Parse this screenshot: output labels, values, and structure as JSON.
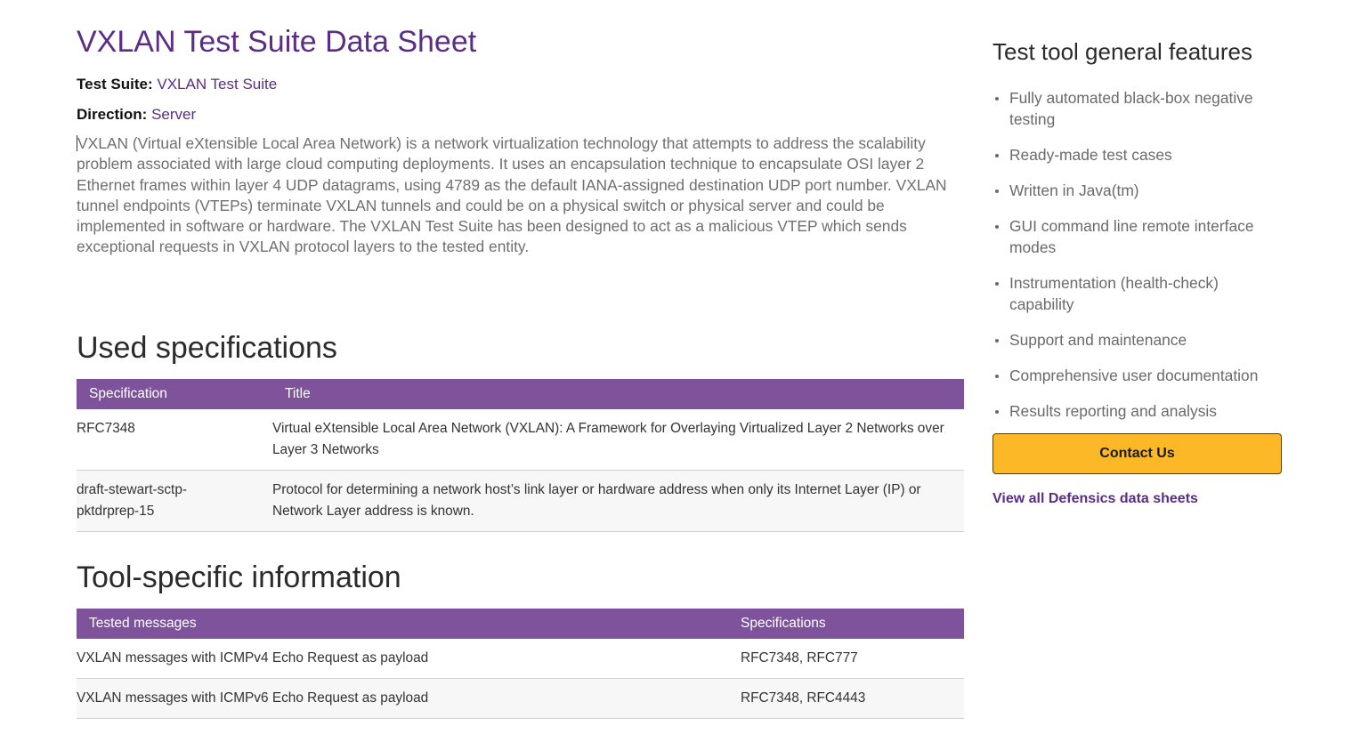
{
  "page": {
    "title": "VXLAN Test Suite Data Sheet",
    "test_suite_label": "Test Suite:",
    "test_suite_value": "VXLAN Test Suite",
    "direction_label": "Direction:",
    "direction_value": "Server",
    "description": "VXLAN (Virtual eXtensible Local Area Network) is a network virtualization technology that attempts to address the scalability problem associated with large cloud computing deployments. It uses an encapsulation technique to encapsulate OSI layer 2 Ethernet frames within layer 4 UDP datagrams, using 4789 as the default IANA-assigned destination UDP port number. VXLAN tunnel endpoints (VTEPs) terminate VXLAN tunnels and could be on a physical switch or physical server and could be implemented in software or hardware. The VXLAN Test Suite has been designed to act as a malicious VTEP which sends exceptional requests in VXLAN protocol layers to the tested entity."
  },
  "used_specs": {
    "heading": "Used specifications",
    "columns": [
      "Specification",
      "Title"
    ],
    "rows": [
      {
        "spec": "RFC7348",
        "title": "Virtual eXtensible Local Area Network (VXLAN): A Framework for Overlaying Virtualized Layer 2 Networks over Layer 3 Networks"
      },
      {
        "spec": "draft-stewart-sctp-pktdrprep-15",
        "title": "Protocol for determining a network host’s link layer or hardware address when only its Internet Layer (IP) or Network Layer address is known."
      }
    ]
  },
  "tool_info": {
    "heading": "Tool-specific information",
    "columns": [
      "Tested messages",
      "Specifications"
    ],
    "rows": [
      {
        "message": "VXLAN messages with ICMPv4 Echo Request as payload",
        "specs": "RFC7348, RFC777"
      },
      {
        "message": "VXLAN messages with ICMPv6 Echo Request as payload",
        "specs": "RFC7348, RFC4443"
      }
    ]
  },
  "sidebar": {
    "heading": "Test tool general features",
    "features": [
      "Fully automated black-box negative testing",
      "Ready-made test cases",
      "Written in Java(tm)",
      "GUI command line remote interface modes",
      "Instrumentation (health-check) capability",
      "Support and maintenance",
      "Comprehensive user documentation",
      "Results reporting and analysis"
    ],
    "contact_label": "Contact Us",
    "view_all_label": "View all Defensics data sheets"
  },
  "colors": {
    "brand_purple": "#5b2d86",
    "table_header": "#7e539b",
    "cta_yellow": "#fdb827"
  }
}
